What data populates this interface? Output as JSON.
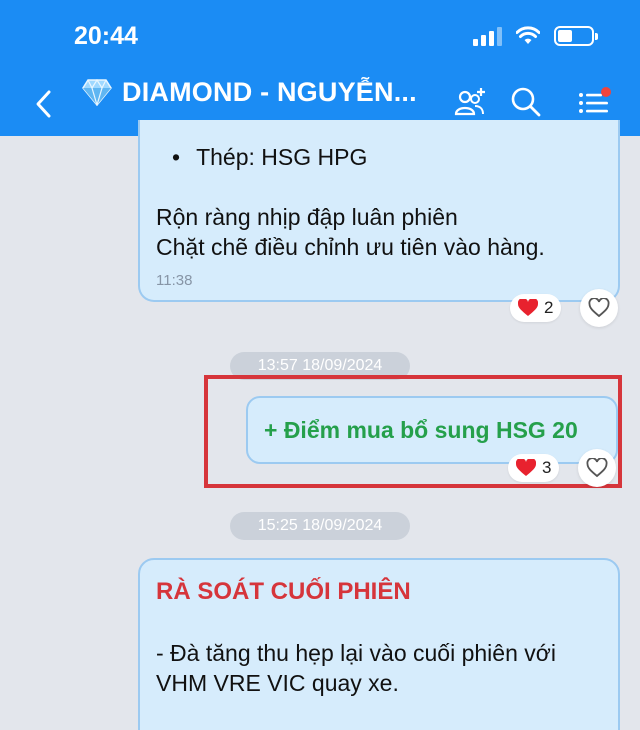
{
  "status_bar": {
    "time": "20:44"
  },
  "header": {
    "title": "DIAMOND - NGUYỄN...",
    "color": "#1b8cf4"
  },
  "messages": [
    {
      "bullet": "Thép: HSG HPG",
      "lines": [
        "Rộn ràng nhịp đập luân phiên",
        "Chặt chẽ điều chỉnh ưu tiên vào hàng."
      ],
      "time": "11:38",
      "reaction": {
        "icon": "heart",
        "count": "2"
      }
    },
    {
      "date": "13:57 18/09/2024",
      "text": "+ Điểm mua bổ sung HSG 20",
      "text_color": "#25a04b",
      "reaction": {
        "icon": "heart",
        "count": "3"
      }
    },
    {
      "date": "15:25 18/09/2024",
      "title": "RÀ SOÁT CUỐI PHIÊN",
      "title_color": "#d6353b",
      "lines": [
        "- Đà tăng thu hẹp lại vào cuối phiên với",
        "VHM VRE VIC quay xe."
      ]
    }
  ],
  "colors": {
    "bubble_bg": "#d6ecfc",
    "bubble_border": "#9ccaf1",
    "highlight": "#d6353b",
    "heart": "#e8222e"
  }
}
